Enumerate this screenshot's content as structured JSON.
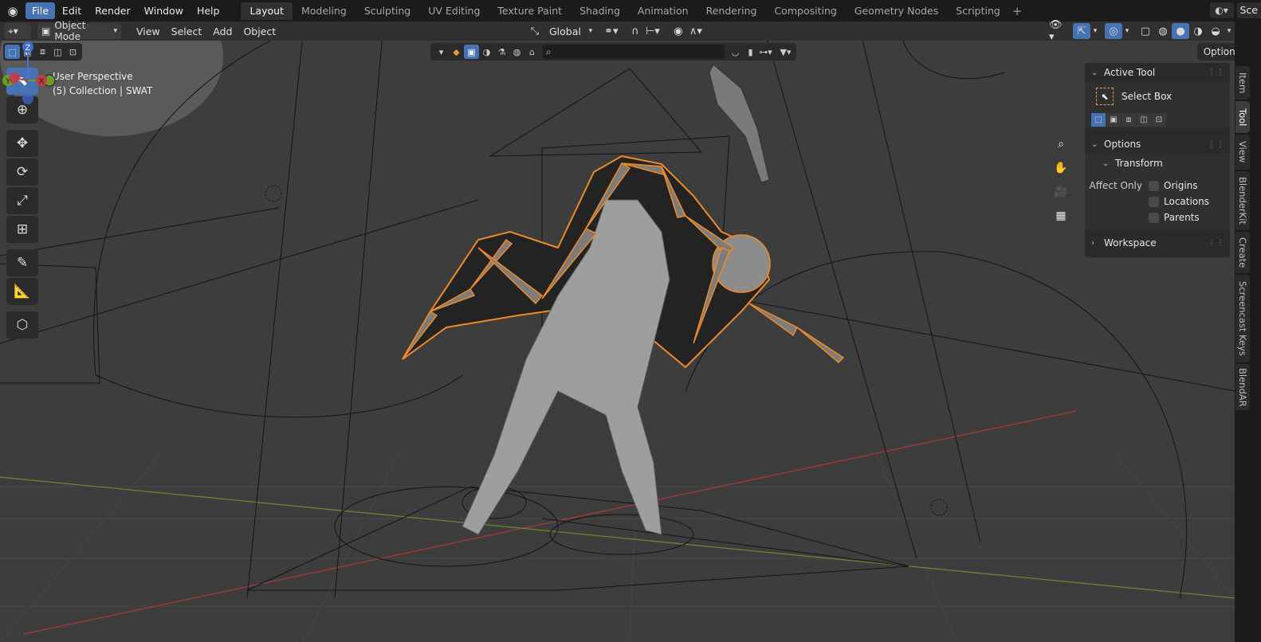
{
  "topbar": {
    "menus": [
      "File",
      "Edit",
      "Render",
      "Window",
      "Help"
    ],
    "workspaces": [
      "Layout",
      "Modeling",
      "Sculpting",
      "UV Editing",
      "Texture Paint",
      "Shading",
      "Animation",
      "Rendering",
      "Compositing",
      "Geometry Nodes",
      "Scripting"
    ],
    "add_icon": "+",
    "scene_label": "Sce"
  },
  "header": {
    "mode": "Object Mode",
    "menus": [
      "View",
      "Select",
      "Add",
      "Object"
    ],
    "transform_orientation": "Global",
    "options_label": "Options"
  },
  "viewport": {
    "perspective_label": "User Perspective",
    "collection_label": "(5) Collection | SWAT",
    "gizmo_axes": [
      "Z",
      "Y",
      "X"
    ]
  },
  "npanel": {
    "active_tool_header": "Active Tool",
    "tool_name": "Select Box",
    "options_header": "Options",
    "transform_header": "Transform",
    "affect_only_label": "Affect Only",
    "checkboxes": [
      "Origins",
      "Locations",
      "Parents"
    ],
    "workspace_header": "Workspace"
  },
  "side_tabs": [
    "Item",
    "Tool",
    "View",
    "BlenderKit",
    "Create",
    "Screencast Keys",
    "BlendAR"
  ],
  "colors": {
    "accent": "#4772b3",
    "selection_orange": "#f08a24",
    "grid_red": "#a83a3a",
    "grid_green": "#6b8a2e"
  }
}
